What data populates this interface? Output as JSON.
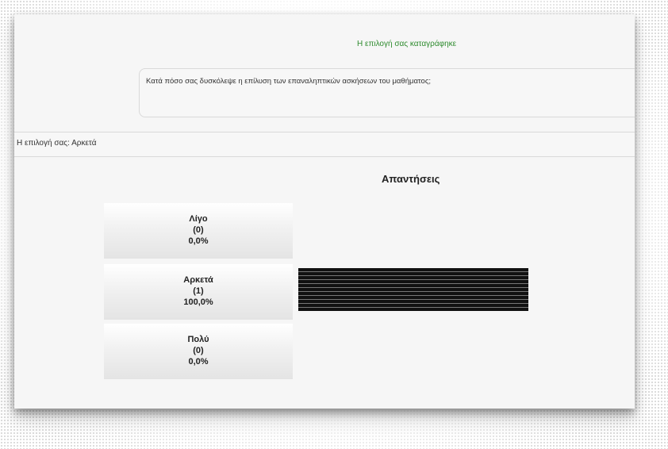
{
  "confirmation": "Η επιλογή σας καταγράφηκε",
  "question": "Κατά πόσο σας δυσκόλεψε η επίλυση των επαναληπτικών ασκήσεων του μαθήματος;",
  "your_choice": "Η επιλογή σας: Αρκετά",
  "results_title": "Απαντήσεις",
  "colors": {
    "confirmation": "#2e8b2e",
    "bar": "#111111"
  },
  "results": [
    {
      "label": "Λίγο",
      "count": "(0)",
      "percent": "0,0%",
      "fraction": 0
    },
    {
      "label": "Αρκετά",
      "count": "(1)",
      "percent": "100,0%",
      "fraction": 1
    },
    {
      "label": "Πολύ",
      "count": "(0)",
      "percent": "0,0%",
      "fraction": 0
    }
  ]
}
